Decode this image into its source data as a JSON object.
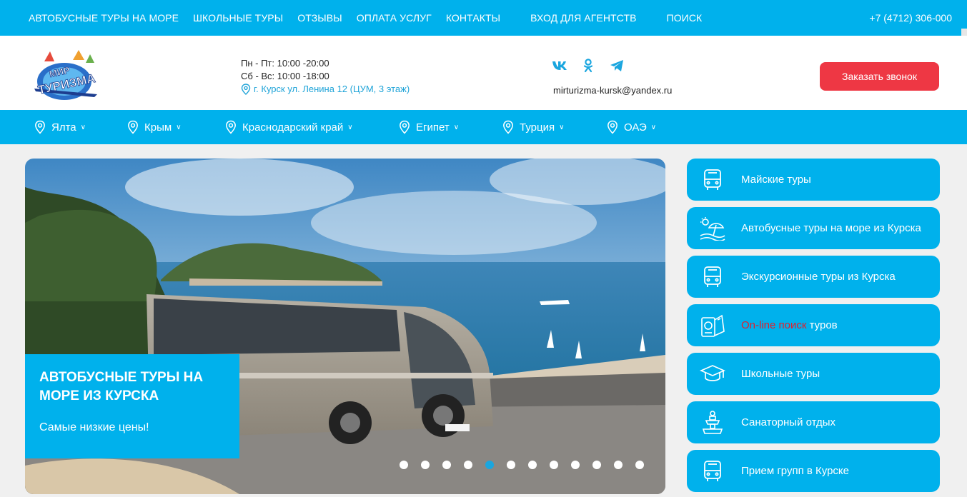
{
  "topnav": {
    "items": [
      "АВТОБУСНЫЕ ТУРЫ НА МОРЕ",
      "ШКОЛЬНЫЕ ТУРЫ",
      "ОТЗЫВЫ",
      "ОПЛАТА УСЛУГ",
      "КОНТАКТЫ"
    ],
    "agency": "ВХОД ДЛЯ АГЕНТСТВ",
    "search": "ПОИСК",
    "phone": "+7 (4712) 306-000"
  },
  "header": {
    "logo_text_line1": "МИР",
    "logo_text_line2": "ТУРИЗМА",
    "hours_weekday": "Пн - Пт: 10:00 -20:00",
    "hours_weekend": "Сб - Вс: 10:00 -18:00",
    "address": "г. Курск ул. Ленина 12 (ЦУМ, 3 этаж)",
    "socials": [
      "vk-icon",
      "odnoklassniki-icon",
      "telegram-icon"
    ],
    "email": "mirturizma-kursk@yandex.ru",
    "call_button": "Заказать звонок"
  },
  "destinations": [
    "Ялта",
    "Крым",
    "Краснодарский край",
    "Египет",
    "Турция",
    "ОАЭ"
  ],
  "slider": {
    "title": "АВТОБУСНЫЕ ТУРЫ НА МОРЕ ИЗ КУРСКА",
    "subtitle": "Самые низкие цены!",
    "dots_count": 12,
    "active_dot": 5
  },
  "side_menu": {
    "item1": "Майские туры",
    "item2": "Автобусные туры на море из Курска",
    "item3": "Экскурсионные туры из Курска",
    "item4_red": "On-line поиск",
    "item4_rest": " туров",
    "item5": "Школьные туры",
    "item6": "Санаторный отдых",
    "item7": "Прием групп в Курске"
  },
  "colors": {
    "accent": "#00b1ec",
    "button_red": "#ee3744",
    "link_blue": "#20a4d8"
  }
}
